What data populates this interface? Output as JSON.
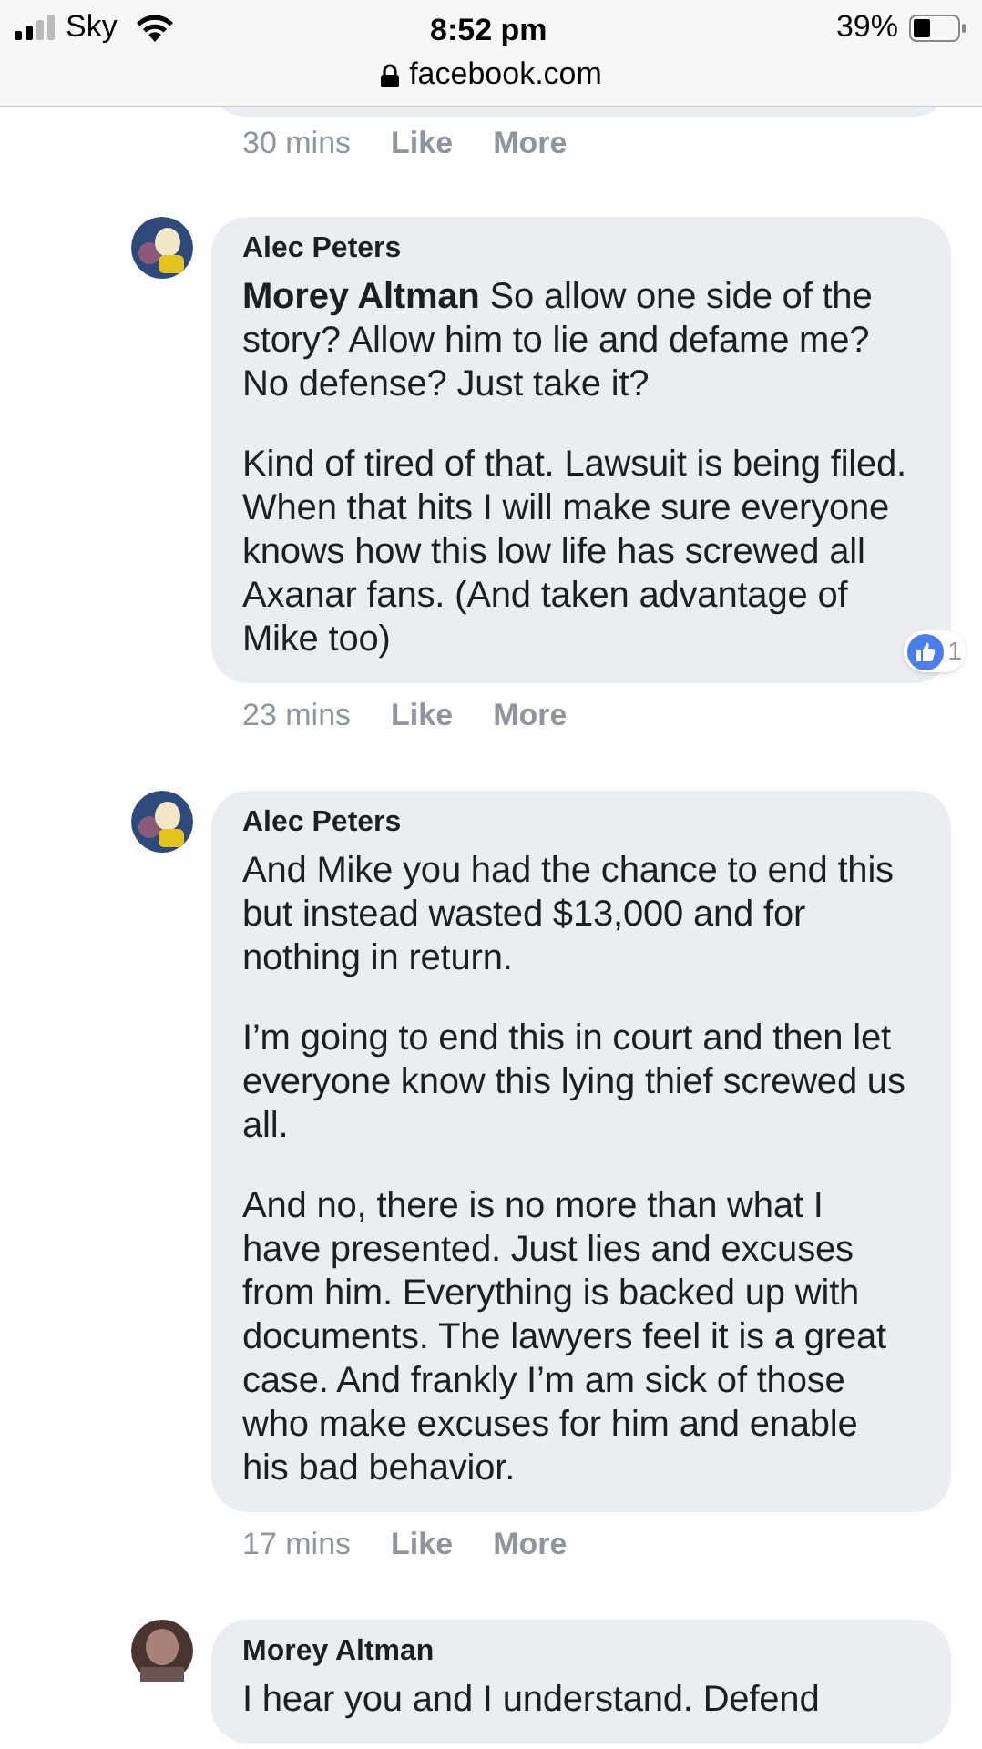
{
  "status_bar": {
    "carrier": "Sky",
    "time": "8:52 pm",
    "battery": "39%"
  },
  "address_bar": {
    "url": "facebook.com"
  },
  "comments": [
    {
      "kind": "partial",
      "time": "30 mins",
      "actions": [
        "Like",
        "More"
      ]
    },
    {
      "kind": "full",
      "author": "Alec Peters",
      "paragraphs": [
        "**Morey Altman** So allow one side of the story? Allow him to lie and defame me? No defense? Just take it?",
        "Kind of tired of that. Lawsuit is being filed. When that hits I will make sure everyone knows how this low life has screwed all Axanar fans. (And taken advantage of Mike too)"
      ],
      "reactions": "1",
      "time": "23 mins",
      "actions": [
        "Like",
        "More"
      ]
    },
    {
      "kind": "full",
      "author": "Alec Peters",
      "paragraphs": [
        "And Mike you had the chance to end this but instead wasted $13,000 and for nothing in return.",
        "I’m going to end this in court and then let everyone know this lying thief screwed us all.",
        "And no, there is no more than what I have presented. Just lies and excuses from him. Everything is backed up with documents. The lawyers feel it is a great case. And frankly I’m am sick of those who make excuses for him and enable his bad behavior."
      ],
      "time": "17 mins",
      "actions": [
        "Like",
        "More"
      ]
    },
    {
      "kind": "full",
      "author": "Morey Altman",
      "paragraphs": [
        "I hear you and I understand. Defend"
      ]
    }
  ]
}
